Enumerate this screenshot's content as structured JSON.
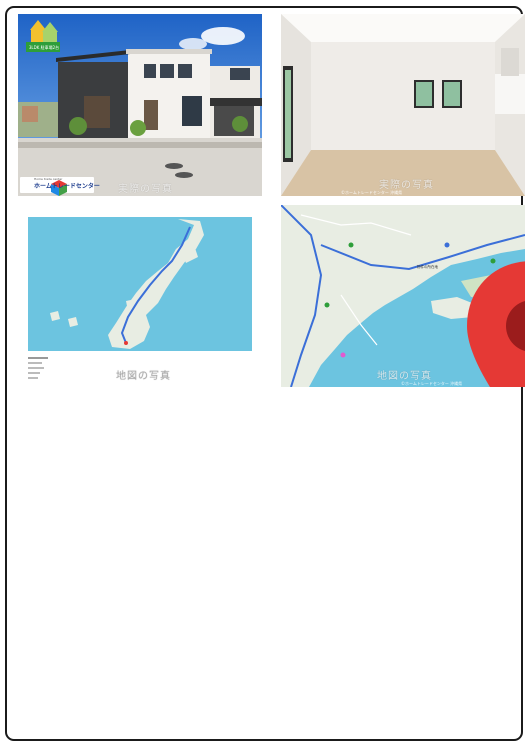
{
  "tiles": [
    {
      "name": "house-exterior-photo",
      "watermark": "実際の写真",
      "badge_text": "3LDK 駐車場2台",
      "logo": {
        "title": "ホームトレードセンター",
        "subtitle": "Home trade center"
      }
    },
    {
      "name": "living-room-photo",
      "watermark": "実際の写真",
      "caption": "©ホームトレードセンター 沖縄県"
    },
    {
      "name": "okinawa-route-map",
      "watermark": "地図の写真"
    },
    {
      "name": "local-area-map",
      "watermark": "地図の写真",
      "pin_label": "物件の所在地",
      "caption": "©ホームトレードセンター 沖縄県"
    }
  ],
  "colors": {
    "frame_border": "#1b1b1b",
    "sea": "#6cc4e0",
    "land": "#e8ede3",
    "route": "#3b6fd8",
    "pin": "#e53935"
  }
}
